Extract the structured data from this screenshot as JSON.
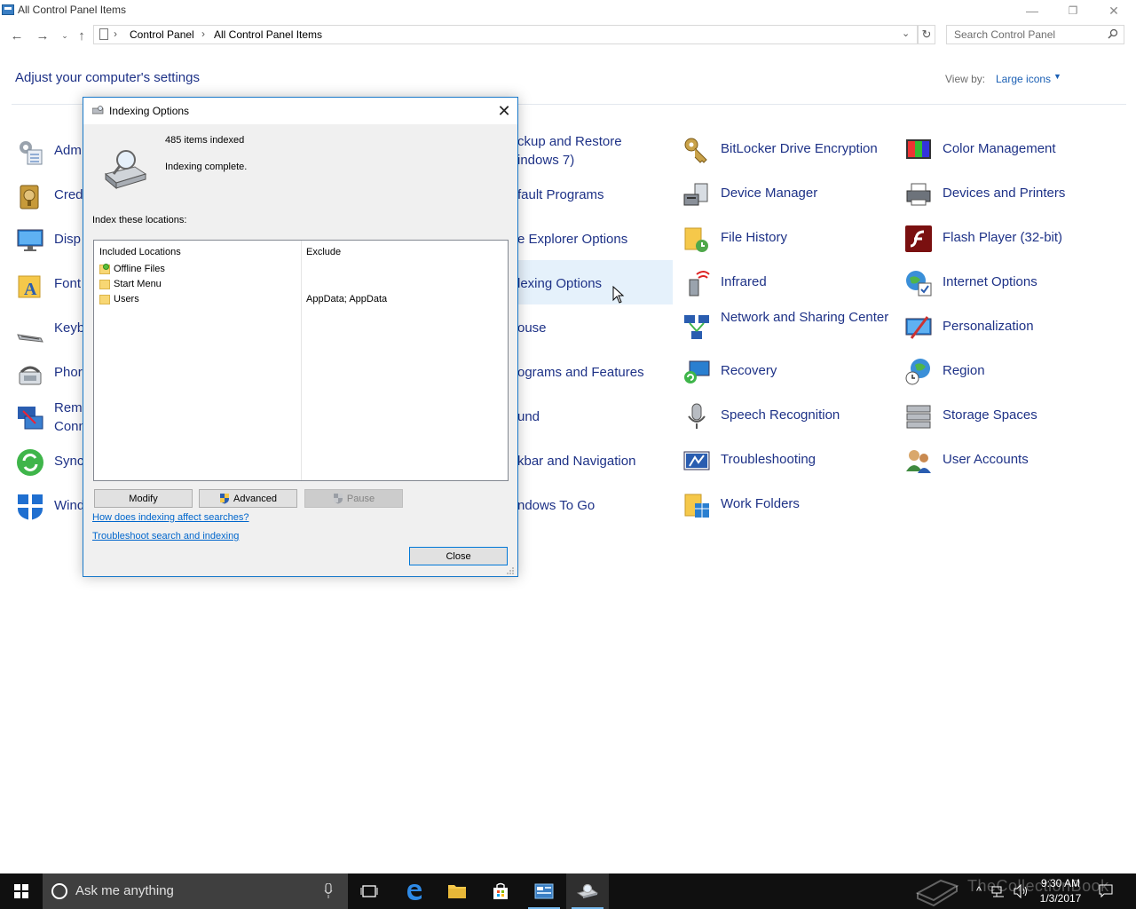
{
  "window": {
    "title": "All Control Panel Items",
    "minimize": "—",
    "maximize": "❐",
    "close": "✕"
  },
  "address": {
    "crumbs": [
      "Control Panel",
      "All Control Panel Items"
    ],
    "separator": "›",
    "search_placeholder": "Search Control Panel"
  },
  "header": {
    "title": "Adjust your computer's settings",
    "view_by_label": "View by:",
    "view_by_value": "Large icons"
  },
  "items": {
    "col1": [
      "Adm",
      "Cred",
      "Disp",
      "Font",
      "Keyb",
      "Phor",
      "Rem\nConn",
      "Sync",
      "Wind"
    ],
    "col2": [
      "ckup and Restore\nindows 7)",
      "fault Programs",
      "e Explorer Options",
      "lexing Options",
      "ouse",
      "ograms and Features",
      "und",
      "kbar and Navigation",
      "ndows To Go"
    ],
    "col3": [
      "BitLocker Drive Encryption",
      "Device Manager",
      "File History",
      "Infrared",
      "Network and Sharing Center",
      "Recovery",
      "Speech Recognition",
      "Troubleshooting",
      "Work Folders"
    ],
    "col4": [
      "Color Management",
      "Devices and Printers",
      "Flash Player (32-bit)",
      "Internet Options",
      "Personalization",
      "Region",
      "Storage Spaces",
      "User Accounts"
    ]
  },
  "dialog": {
    "title": "Indexing Options",
    "close_x": "✕",
    "items_indexed": "485 items indexed",
    "status": "Indexing complete.",
    "index_label": "Index these locations:",
    "col_included": "Included Locations",
    "col_exclude": "Exclude",
    "locations": [
      {
        "name": "Offline Files",
        "exclude": ""
      },
      {
        "name": "Start Menu",
        "exclude": ""
      },
      {
        "name": "Users",
        "exclude": "AppData; AppData"
      }
    ],
    "btn_modify": "Modify",
    "btn_advanced": "Advanced",
    "btn_pause": "Pause",
    "link_affect": "How does indexing affect searches?",
    "link_troubleshoot": "Troubleshoot search and indexing",
    "btn_close": "Close"
  },
  "taskbar": {
    "search_text": "Ask me anything",
    "watermark": "TheCollectionBook",
    "time": "9:30 AM",
    "date": "1/3/2017"
  },
  "colors": {
    "link_blue": "#1e3287",
    "accent": "#0078d7",
    "taskbar": "#101010"
  }
}
